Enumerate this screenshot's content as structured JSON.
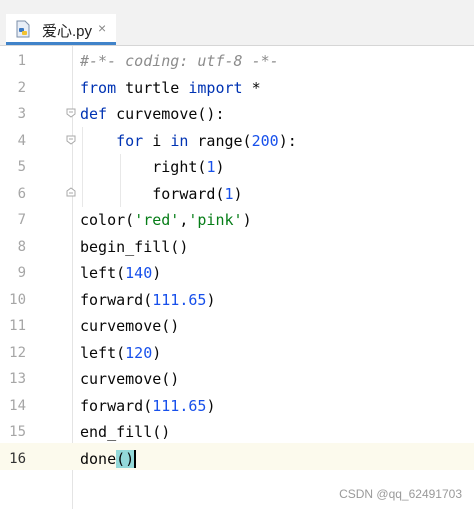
{
  "tab": {
    "filename": "爱心.py",
    "icon": "python-file-icon",
    "close": "×"
  },
  "lines": [
    {
      "n": "1",
      "parts": [
        {
          "t": "#-*- coding: utf-8 -*-",
          "c": "cmt"
        }
      ]
    },
    {
      "n": "2",
      "parts": [
        {
          "t": "from",
          "c": "kw"
        },
        {
          "t": " turtle ",
          "c": ""
        },
        {
          "t": "import",
          "c": "kw"
        },
        {
          "t": " *",
          "c": ""
        }
      ]
    },
    {
      "n": "3",
      "parts": [
        {
          "t": "def",
          "c": "kw"
        },
        {
          "t": " curvemove():",
          "c": ""
        }
      ]
    },
    {
      "n": "4",
      "parts": [
        {
          "t": "    ",
          "c": ""
        },
        {
          "t": "for",
          "c": "kw"
        },
        {
          "t": " i ",
          "c": ""
        },
        {
          "t": "in",
          "c": "kw"
        },
        {
          "t": " range(",
          "c": ""
        },
        {
          "t": "200",
          "c": "num"
        },
        {
          "t": "):",
          "c": ""
        }
      ]
    },
    {
      "n": "5",
      "parts": [
        {
          "t": "        right(",
          "c": ""
        },
        {
          "t": "1",
          "c": "num"
        },
        {
          "t": ")",
          "c": ""
        }
      ]
    },
    {
      "n": "6",
      "parts": [
        {
          "t": "        forward(",
          "c": ""
        },
        {
          "t": "1",
          "c": "num"
        },
        {
          "t": ")",
          "c": ""
        }
      ]
    },
    {
      "n": "7",
      "parts": [
        {
          "t": "color(",
          "c": ""
        },
        {
          "t": "'red'",
          "c": "str"
        },
        {
          "t": ",",
          "c": ""
        },
        {
          "t": "'pink'",
          "c": "str"
        },
        {
          "t": ")",
          "c": ""
        }
      ]
    },
    {
      "n": "8",
      "parts": [
        {
          "t": "begin_fill()",
          "c": ""
        }
      ]
    },
    {
      "n": "9",
      "parts": [
        {
          "t": "left(",
          "c": ""
        },
        {
          "t": "140",
          "c": "num"
        },
        {
          "t": ")",
          "c": ""
        }
      ]
    },
    {
      "n": "10",
      "parts": [
        {
          "t": "forward(",
          "c": ""
        },
        {
          "t": "111.65",
          "c": "num"
        },
        {
          "t": ")",
          "c": ""
        }
      ]
    },
    {
      "n": "11",
      "parts": [
        {
          "t": "curvemove()",
          "c": ""
        }
      ]
    },
    {
      "n": "12",
      "parts": [
        {
          "t": "left(",
          "c": ""
        },
        {
          "t": "120",
          "c": "num"
        },
        {
          "t": ")",
          "c": ""
        }
      ]
    },
    {
      "n": "13",
      "parts": [
        {
          "t": "curvemove()",
          "c": ""
        }
      ]
    },
    {
      "n": "14",
      "parts": [
        {
          "t": "forward(",
          "c": ""
        },
        {
          "t": "111.65",
          "c": "num"
        },
        {
          "t": ")",
          "c": ""
        }
      ]
    },
    {
      "n": "15",
      "parts": [
        {
          "t": "end_fill()",
          "c": ""
        }
      ]
    },
    {
      "n": "16",
      "parts": [
        {
          "t": "done",
          "c": ""
        },
        {
          "t": "()",
          "c": "caret-hl"
        }
      ]
    }
  ],
  "current_line": "16",
  "watermark": "CSDN @qq_62491703",
  "colors": {
    "keyword": "#0033b3",
    "number": "#1750eb",
    "string": "#067d17",
    "comment": "#8c8c8c",
    "tab_underline": "#4083c9"
  }
}
